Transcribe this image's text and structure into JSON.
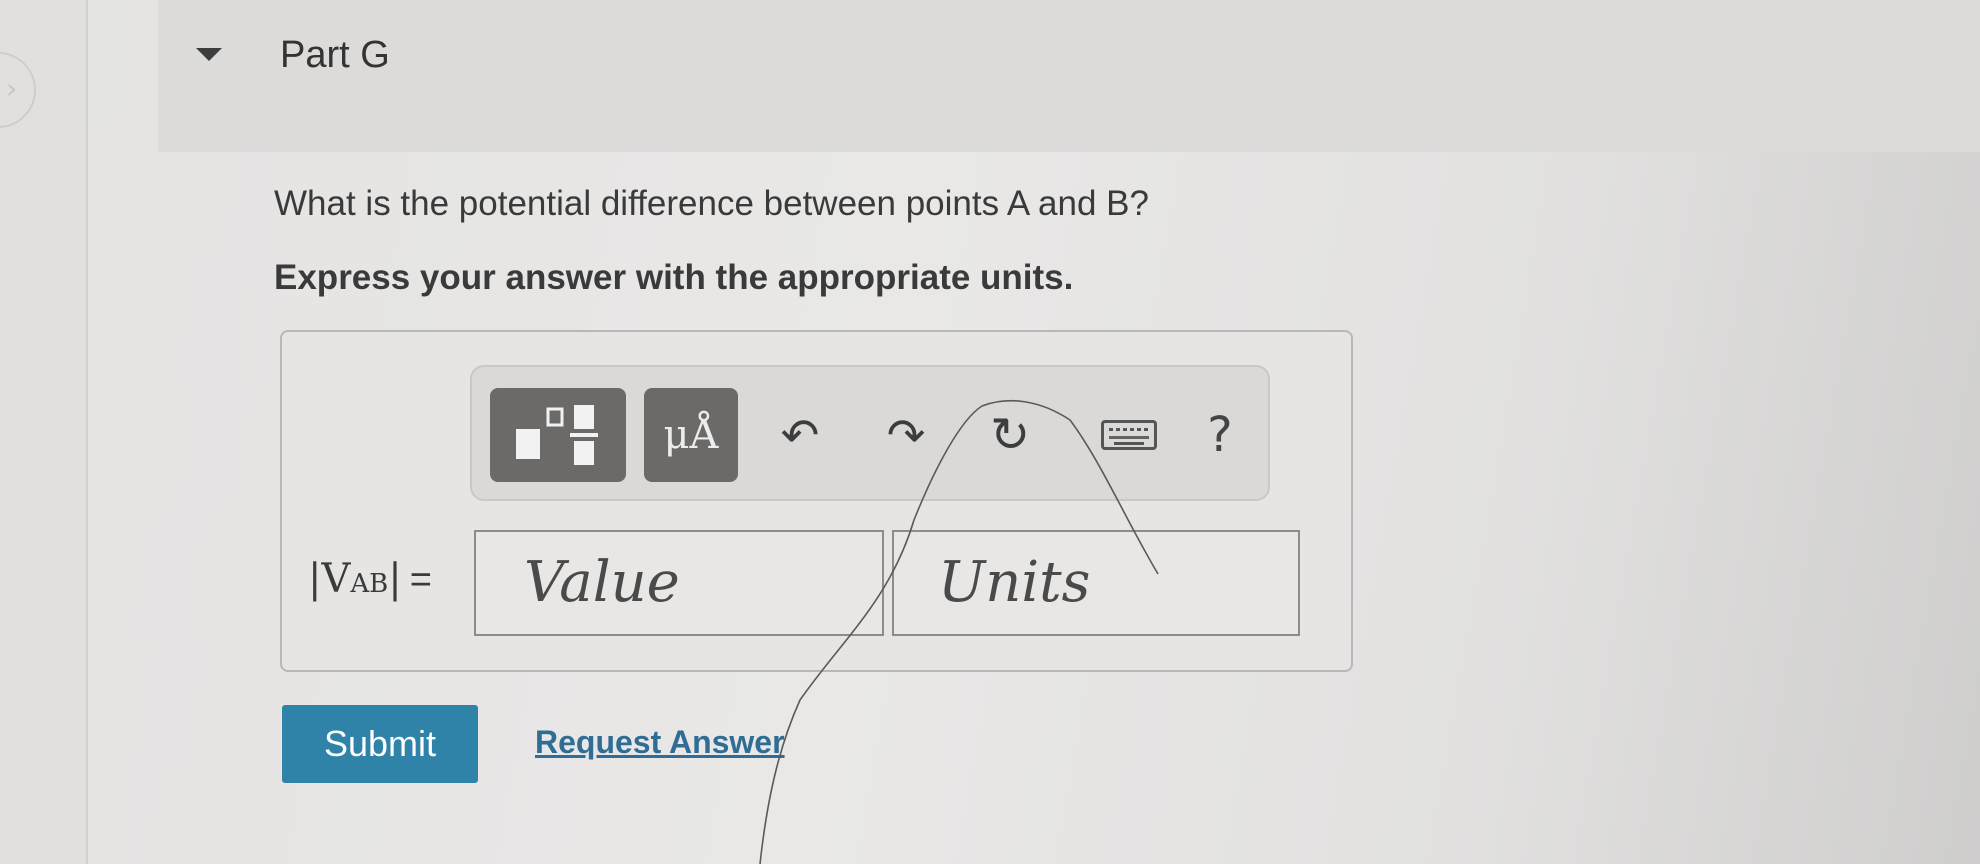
{
  "part": {
    "title": "Part G"
  },
  "question": {
    "prompt": "What is the potential difference between points A and B?",
    "instruction": "Express your answer with the appropriate units."
  },
  "toolbar": {
    "units_label": "μÅ",
    "undo_glyph": "↶",
    "redo_glyph": "↷",
    "reset_glyph": "↻",
    "help_label": "?"
  },
  "answer": {
    "label_prefix": "|V",
    "label_subscript": "AB",
    "label_suffix": "|",
    "equals": "=",
    "value_placeholder": "Value",
    "units_placeholder": "Units"
  },
  "actions": {
    "submit_label": "Submit",
    "request_answer_label": "Request Answer"
  }
}
